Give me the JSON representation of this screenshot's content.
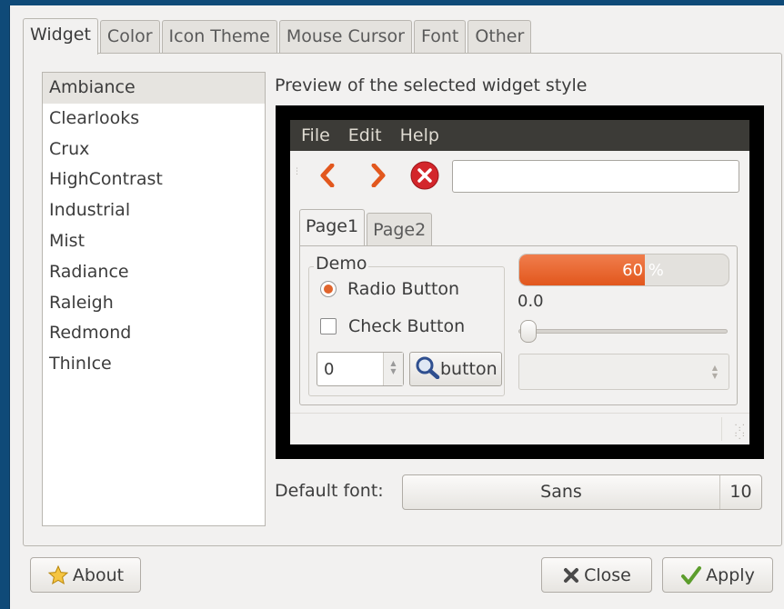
{
  "tabs": [
    "Widget",
    "Color",
    "Icon Theme",
    "Mouse Cursor",
    "Font",
    "Other"
  ],
  "active_tab": "Widget",
  "themes": [
    "Ambiance",
    "Clearlooks",
    "Crux",
    "HighContrast",
    "Industrial",
    "Mist",
    "Radiance",
    "Raleigh",
    "Redmond",
    "ThinIce"
  ],
  "selected_theme": "Ambiance",
  "preview": {
    "label": "Preview of the selected widget style",
    "menu": [
      "File",
      "Edit",
      "Help"
    ],
    "toolbar_icons": [
      "back-arrow-icon",
      "forward-arrow-icon",
      "stop-icon"
    ],
    "url_value": "",
    "tabs": [
      "Page1",
      "Page2"
    ],
    "active_tab": "Page1",
    "frame_label": "Demo",
    "radio_label": "Radio Button",
    "radio_checked": true,
    "check_label": "Check Button",
    "check_checked": false,
    "spin_value": "0",
    "search_button_label": "button",
    "progress_text": "60 %",
    "progress_fraction": 0.6,
    "scale_value": "0.0",
    "slider_fraction": 0.0,
    "accent_color": "#e2571d"
  },
  "font": {
    "label": "Default font:",
    "name": "Sans",
    "size": "10"
  },
  "buttons": {
    "about": "About",
    "close": "Close",
    "apply": "Apply"
  }
}
